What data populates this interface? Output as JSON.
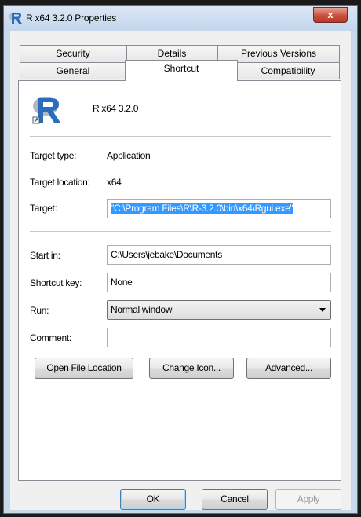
{
  "window": {
    "title": "R x64 3.2.0 Properties",
    "close_label": "x"
  },
  "tabs_row1": [
    "Security",
    "Details",
    "Previous Versions"
  ],
  "tabs_row2": [
    "General",
    "Shortcut",
    "Compatibility"
  ],
  "active_tab": "Shortcut",
  "header": {
    "app_name": "R x64 3.2.0",
    "icon": "r-logo-icon"
  },
  "fields": {
    "target_type_label": "Target type:",
    "target_type_value": "Application",
    "target_location_label": "Target location:",
    "target_location_value": "x64",
    "target_label": "Target:",
    "target_value": "\"C:\\Program Files\\R\\R-3.2.0\\bin\\x64\\Rgui.exe\"",
    "start_in_label": "Start in:",
    "start_in_value": "C:\\Users\\jebake\\Documents",
    "shortcut_key_label": "Shortcut key:",
    "shortcut_key_value": "None",
    "run_label": "Run:",
    "run_value": "Normal window",
    "comment_label": "Comment:",
    "comment_value": ""
  },
  "actions": {
    "open_file_location": "Open File Location",
    "change_icon": "Change Icon...",
    "advanced": "Advanced..."
  },
  "footer": {
    "ok": "OK",
    "cancel": "Cancel",
    "apply": "Apply"
  },
  "colors": {
    "titlebar": "#c4d6ec",
    "close_button": "#c9503f",
    "selection": "#3399ff",
    "r_logo_blue": "#2a6ebb"
  }
}
